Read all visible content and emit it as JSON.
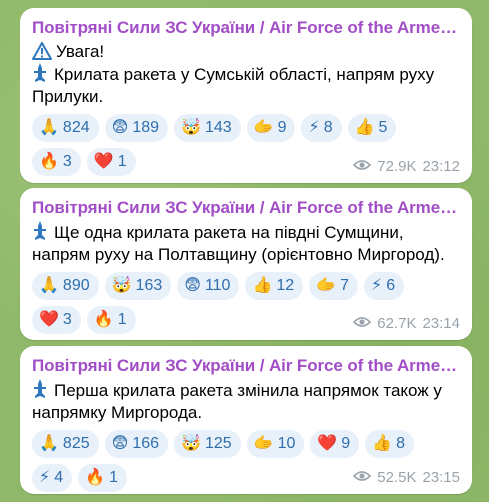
{
  "messages": [
    {
      "author": "Повітряні Сили ЗС України / Air Force of the Armed F...",
      "lines": [
        {
          "icon": "warning-icon",
          "text": "Увага!"
        },
        {
          "icon": "missile-icon",
          "text": "Крилата ракета у Сумській області, напрям руху"
        },
        {
          "icon": "",
          "text": "Прилуки."
        }
      ],
      "reactions": [
        [
          {
            "emoji": "🙏",
            "count": "824"
          },
          {
            "emoji": "😨",
            "count": "189"
          },
          {
            "emoji": "🤯",
            "count": "143"
          },
          {
            "emoji": "🫱",
            "count": "9"
          },
          {
            "emoji": "⚡",
            "count": "8"
          },
          {
            "emoji": "👍",
            "count": "5"
          }
        ],
        [
          {
            "emoji": "🔥",
            "count": "3"
          },
          {
            "emoji": "❤️",
            "count": "1"
          }
        ]
      ],
      "views": "72.9K",
      "time": "23:12"
    },
    {
      "author": "Повітряні Сили ЗС України / Air Force of the Armed F...",
      "lines": [
        {
          "icon": "missile-icon",
          "text": "Ще одна крилата ракета на півдні Сумщини,"
        },
        {
          "icon": "",
          "text": "напрям руху на Полтавщину (орієнтовно Миргород)."
        }
      ],
      "reactions": [
        [
          {
            "emoji": "🙏",
            "count": "890"
          },
          {
            "emoji": "🤯",
            "count": "163"
          },
          {
            "emoji": "😨",
            "count": "110"
          },
          {
            "emoji": "👍",
            "count": "12"
          },
          {
            "emoji": "🫱",
            "count": "7"
          },
          {
            "emoji": "⚡",
            "count": "6"
          }
        ],
        [
          {
            "emoji": "❤️",
            "count": "3"
          },
          {
            "emoji": "🔥",
            "count": "1"
          }
        ]
      ],
      "views": "62.7K",
      "time": "23:14"
    },
    {
      "author": "Повітряні Сили ЗС України / Air Force of the Armed F...",
      "lines": [
        {
          "icon": "missile-icon",
          "text": "Перша крилата ракета змінила напрямок також у"
        },
        {
          "icon": "",
          "text": "напрямку Миргорода."
        }
      ],
      "reactions": [
        [
          {
            "emoji": "🙏",
            "count": "825"
          },
          {
            "emoji": "😨",
            "count": "166"
          },
          {
            "emoji": "🤯",
            "count": "125"
          },
          {
            "emoji": "🫱",
            "count": "10"
          },
          {
            "emoji": "❤️",
            "count": "9"
          },
          {
            "emoji": "👍",
            "count": "8"
          }
        ],
        [
          {
            "emoji": "⚡",
            "count": "4"
          },
          {
            "emoji": "🔥",
            "count": "1"
          }
        ]
      ],
      "views": "52.5K",
      "time": "23:15"
    }
  ],
  "colors": {
    "author": "#a24fc7",
    "chip_bg": "#e8f0f9",
    "chip_text": "#2f6fad",
    "meta": "#9aa3ab",
    "background": "#8fb86a"
  }
}
